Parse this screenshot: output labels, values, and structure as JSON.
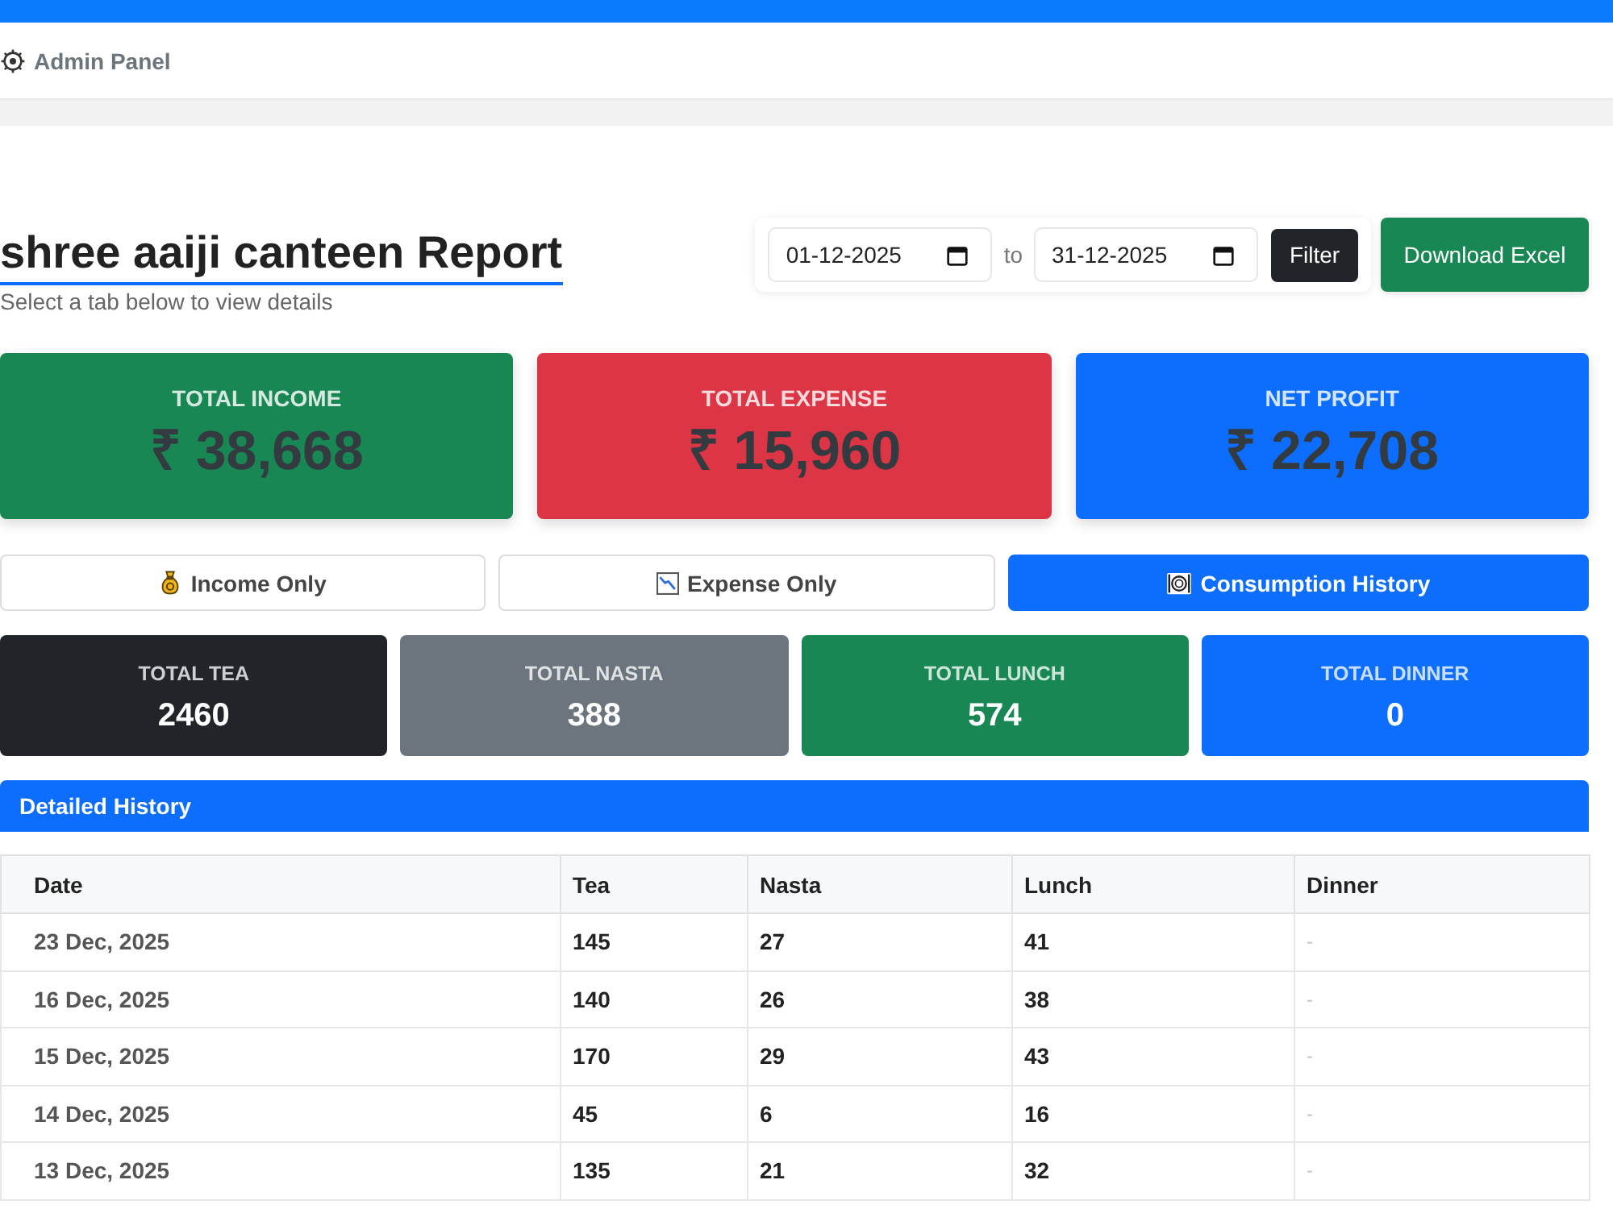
{
  "navbar": {
    "brand": "Admin Panel"
  },
  "header": {
    "title": "shree aaiji canteen Report",
    "subtitle": "Select a tab below to view details"
  },
  "filter": {
    "from": "01-12-2025",
    "separator": "to",
    "to": "31-12-2025",
    "button": "Filter"
  },
  "download_button": "Download Excel",
  "summary_cards": [
    {
      "label": "TOTAL INCOME",
      "value": "₹ 38,668",
      "color": "#198754"
    },
    {
      "label": "TOTAL EXPENSE",
      "value": "₹ 15,960",
      "color": "#dc3545"
    },
    {
      "label": "NET PROFIT",
      "value": "₹ 22,708",
      "color": "#0d6efd"
    }
  ],
  "tabs": [
    {
      "label": "Income Only",
      "kind": "income",
      "selected": false
    },
    {
      "label": "Expense Only",
      "kind": "expense",
      "selected": false
    },
    {
      "label": "Consumption History",
      "kind": "consumption",
      "selected": true
    }
  ],
  "consumption_cards": [
    {
      "label": "TOTAL TEA",
      "value": "2460",
      "color": "#212529"
    },
    {
      "label": "TOTAL NASTA",
      "value": "388",
      "color": "#6c757d"
    },
    {
      "label": "TOTAL LUNCH",
      "value": "574",
      "color": "#198754"
    },
    {
      "label": "TOTAL DINNER",
      "value": "0",
      "color": "#0d6efd"
    }
  ],
  "history": {
    "title": "Detailed History",
    "columns": [
      {
        "label": "Date",
        "kind": "date"
      },
      {
        "label": "Tea",
        "kind": "count"
      },
      {
        "label": "Nasta",
        "kind": "count"
      },
      {
        "label": "Lunch",
        "kind": "count"
      },
      {
        "label": "Dinner",
        "kind": "blank"
      }
    ],
    "rows": [
      [
        "23 Dec, 2025",
        "145",
        "27",
        "41",
        "-"
      ],
      [
        "16 Dec, 2025",
        "140",
        "26",
        "38",
        "-"
      ],
      [
        "15 Dec, 2025",
        "170",
        "29",
        "43",
        "-"
      ],
      [
        "14 Dec, 2025",
        "45",
        "6",
        "16",
        "-"
      ],
      [
        "13 Dec, 2025",
        "135",
        "21",
        "32",
        "-"
      ]
    ]
  }
}
